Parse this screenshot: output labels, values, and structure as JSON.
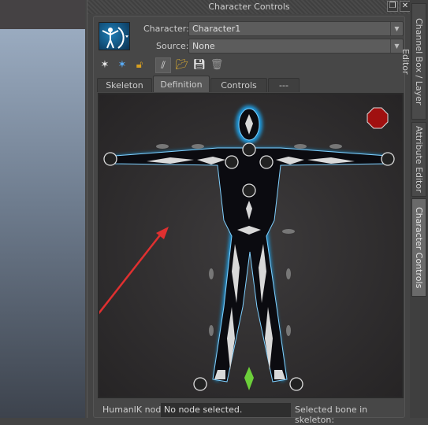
{
  "window": {
    "title": "Character Controls"
  },
  "form": {
    "character_label": "Character:",
    "character_value": "Character1",
    "source_label": "Source:",
    "source_value": "None"
  },
  "toolbar": {
    "icons": [
      "create-character-icon",
      "create-skeleton-icon",
      "lock-icon",
      "mirror-icon",
      "load-icon",
      "save-icon",
      "delete-icon"
    ]
  },
  "tabs": [
    {
      "label": "Skeleton"
    },
    {
      "label": "Definition",
      "active": true
    },
    {
      "label": "Controls"
    },
    {
      "label": "---"
    }
  ],
  "status": {
    "node_label": "HumanIK node",
    "node_value": "No node selected.",
    "bone_label": "Selected bone in skeleton:"
  },
  "side_tabs": [
    {
      "label": "Channel Box / Layer Editor"
    },
    {
      "label": "Attribute Editor"
    },
    {
      "label": "Character Controls",
      "active": true
    }
  ],
  "colors": {
    "stop_button": "#a01010",
    "figure_glow": "#1e9be0",
    "annotation_arrow": "#e03030",
    "selected_bone": "#6ccf3a"
  }
}
